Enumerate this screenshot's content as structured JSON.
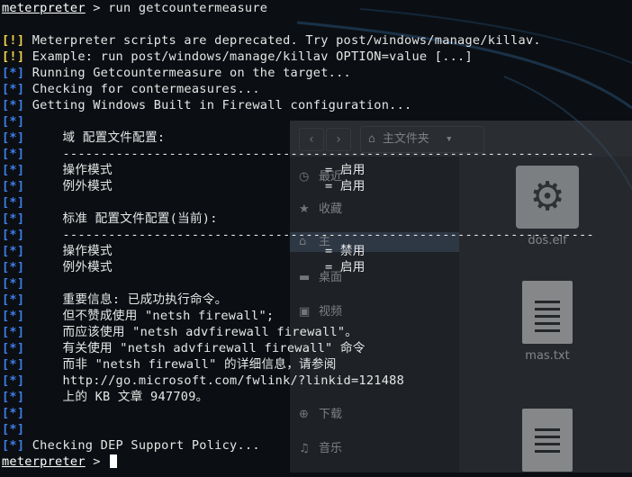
{
  "terminal": {
    "command_line": {
      "prompt": "meterpreter",
      "command": " > run getcountermeasure"
    },
    "lines": [
      {
        "tag": "[!]",
        "kind": "warn",
        "text": " Meterpreter scripts are deprecated. Try post/windows/manage/killav."
      },
      {
        "tag": "[!]",
        "kind": "warn",
        "text": " Example: run post/windows/manage/killav OPTION=value [...]"
      },
      {
        "tag": "[*]",
        "kind": "info",
        "text": " Running Getcountermeasure on the target..."
      },
      {
        "tag": "[*]",
        "kind": "info",
        "text": " Checking for contermeasures..."
      },
      {
        "tag": "[*]",
        "kind": "info",
        "text": " Getting Windows Built in Firewall configuration..."
      },
      {
        "tag": "[*]",
        "kind": "info",
        "text": ""
      },
      {
        "tag": "[*]",
        "kind": "info",
        "text": "     域 配置文件配置:"
      },
      {
        "tag": "[*]",
        "kind": "info",
        "text": "     ----------------------------------------------------------------------"
      },
      {
        "tag": "[*]",
        "kind": "info",
        "text": "     操作模式                            = 启用"
      },
      {
        "tag": "[*]",
        "kind": "info",
        "text": "     例外模式                            = 启用"
      },
      {
        "tag": "[*]",
        "kind": "info",
        "text": ""
      },
      {
        "tag": "[*]",
        "kind": "info",
        "text": "     标准 配置文件配置(当前):"
      },
      {
        "tag": "[*]",
        "kind": "info",
        "text": "     ----------------------------------------------------------------------"
      },
      {
        "tag": "[*]",
        "kind": "info",
        "text": "     操作模式                            = 禁用"
      },
      {
        "tag": "[*]",
        "kind": "info",
        "text": "     例外模式                            = 启用"
      },
      {
        "tag": "[*]",
        "kind": "info",
        "text": ""
      },
      {
        "tag": "[*]",
        "kind": "info",
        "text": "     重要信息: 已成功执行命令。"
      },
      {
        "tag": "[*]",
        "kind": "info",
        "text": "     但不赞成使用 \"netsh firewall\";"
      },
      {
        "tag": "[*]",
        "kind": "info",
        "text": "     而应该使用 \"netsh advfirewall firewall\"。"
      },
      {
        "tag": "[*]",
        "kind": "info",
        "text": "     有关使用 \"netsh advfirewall firewall\" 命令"
      },
      {
        "tag": "[*]",
        "kind": "info",
        "text": "     而非 \"netsh firewall\" 的详细信息，请参阅"
      },
      {
        "tag": "[*]",
        "kind": "info",
        "text": "     http://go.microsoft.com/fwlink/?linkid=121488"
      },
      {
        "tag": "[*]",
        "kind": "info",
        "text": "     上的 KB 文章 947709。"
      },
      {
        "tag": "[*]",
        "kind": "info",
        "text": ""
      },
      {
        "tag": "[*]",
        "kind": "info",
        "text": ""
      },
      {
        "tag": "[*]",
        "kind": "info",
        "text": " Checking DEP Support Policy..."
      }
    ],
    "final_prompt": {
      "prompt": "meterpreter",
      "suffix": " > "
    }
  },
  "file_manager": {
    "breadcrumb": "主文件夹",
    "sidebar": [
      {
        "icon": "clock-icon",
        "glyph": "◷",
        "label": "最近"
      },
      {
        "icon": "star-icon",
        "glyph": "★",
        "label": "收藏"
      },
      {
        "icon": "home-icon",
        "glyph": "⌂",
        "label": "主"
      },
      {
        "icon": "desktop-icon",
        "glyph": "▬",
        "label": "桌面"
      },
      {
        "icon": "video-icon",
        "glyph": "▣",
        "label": "视频"
      },
      {
        "icon": "download-icon",
        "glyph": "⊕",
        "label": "下载"
      },
      {
        "icon": "music-icon",
        "glyph": "♫",
        "label": "音乐"
      }
    ],
    "files": [
      {
        "name": "dos.elf",
        "icon": "gear-icon"
      },
      {
        "name": "mas.txt",
        "icon": "text-file-icon"
      }
    ]
  },
  "colors": {
    "warn_tag": "#f0d34a",
    "info_tag": "#3f7ee8",
    "text": "#e6e6e6",
    "background": "#0b0f13"
  }
}
